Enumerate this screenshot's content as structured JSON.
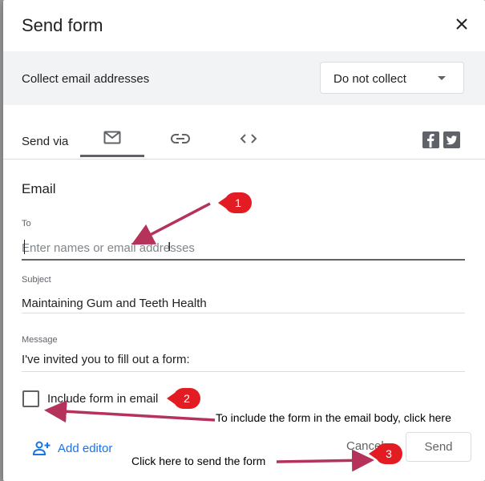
{
  "dialog": {
    "title": "Send form",
    "close_icon": "close-icon"
  },
  "collect": {
    "label": "Collect email addresses",
    "selected": "Do not collect"
  },
  "send_via": {
    "label": "Send via",
    "tabs": [
      {
        "icon": "email-icon",
        "active": true
      },
      {
        "icon": "link-icon",
        "active": false
      },
      {
        "icon": "embed-icon",
        "active": false
      }
    ],
    "social": [
      "facebook-icon",
      "twitter-icon"
    ]
  },
  "email": {
    "section_title": "Email",
    "to_label": "To",
    "to_placeholder": "Enter names or email addresses",
    "to_value": "",
    "subject_label": "Subject",
    "subject_value": "Maintaining Gum and Teeth Health",
    "message_label": "Message",
    "message_value": "I've invited you to fill out a form:",
    "include_form_label": "Include form in email",
    "include_form_checked": false
  },
  "footer": {
    "add_editor_label": "Add editor",
    "cancel_label": "Cancel",
    "send_label": "Send"
  },
  "annotations": {
    "badge_1": "1",
    "badge_2": "2",
    "badge_3": "3",
    "note_2": "To include the form in the email body, click here",
    "note_3": "Click here to send the form",
    "accent_color": "#e31b23",
    "arrow_color": "#b5325a"
  }
}
